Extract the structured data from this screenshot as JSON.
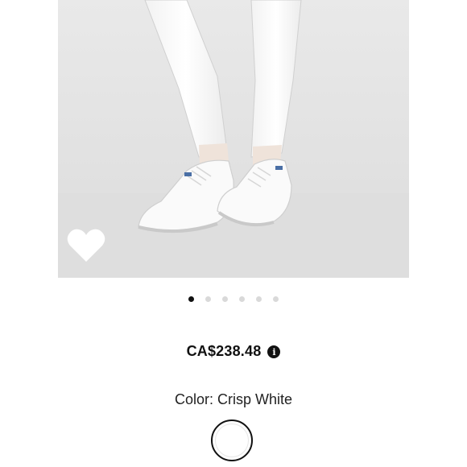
{
  "gallery": {
    "image_alt": "Keds Champion sneakers product photo",
    "total_images": 6,
    "active_index": 0,
    "favorite_icon": "heart-icon"
  },
  "product": {
    "price": "CA$238.48",
    "info_icon_glyph": "i",
    "color_label": "Color: Crisp White",
    "selected_color": "#ffffff"
  },
  "colors": {
    "background": "#ffffff",
    "text": "#111111",
    "dot_inactive": "#d9d9d9",
    "dot_active": "#111111"
  }
}
